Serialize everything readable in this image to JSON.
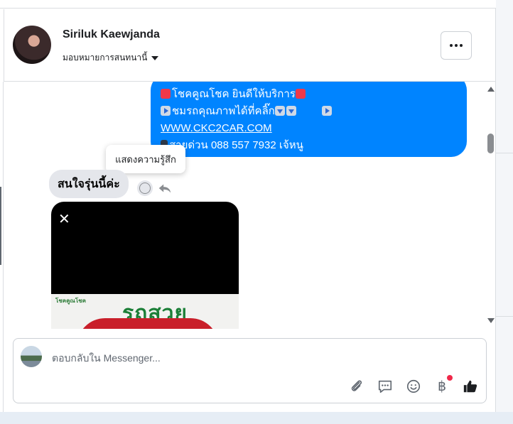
{
  "conversation": {
    "contact_name": "Siriluk Kaewjanda",
    "assign_label": "มอบหมายการสนทนานี้",
    "more_label": "More options"
  },
  "messages": {
    "outgoing": {
      "line1": "โชคคูณโชค ยินดีให้บริการ",
      "line2": "ชมรถคุณภาพได้ที่คลิ๊ก",
      "link": "WWW.CKC2CAR.COM",
      "line4": "สายด่วน 088 557 7932 เจ้หนู"
    },
    "tooltip": "แสดงความรู้สึก",
    "incoming": "สนใจรุ่นนี้ค่ะ",
    "attachment": {
      "brand": "โชคคูณโชค",
      "headline": "รถสวย"
    }
  },
  "composer": {
    "placeholder": "ตอบกลับใน Messenger...",
    "currency_symbol": "฿"
  },
  "icons": [
    "avatar",
    "more-icon",
    "emoji-reaction-icon",
    "reply-icon",
    "close-icon",
    "attachment-icon",
    "saved-reply-icon",
    "emoji-icon",
    "payment-icon",
    "like-icon"
  ],
  "colors": {
    "outgoing_bubble": "#0084ff",
    "incoming_bubble": "#e4e6eb",
    "notification_dot": "#f02849"
  }
}
